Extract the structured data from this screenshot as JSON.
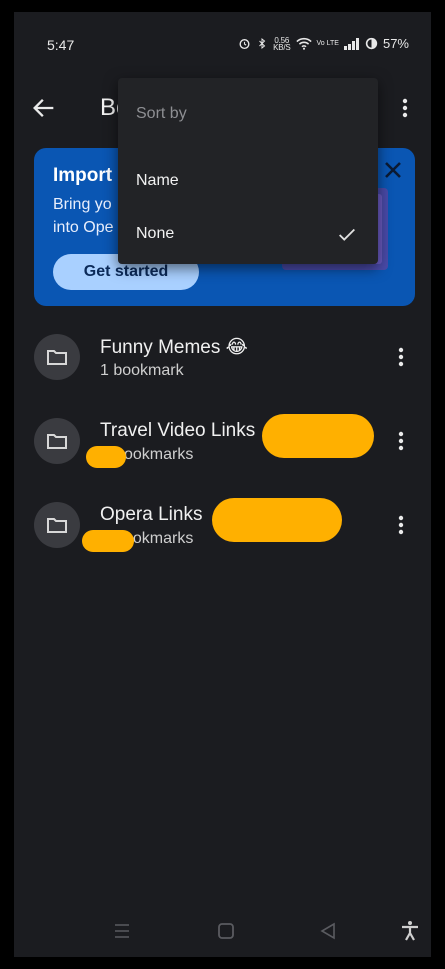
{
  "status_bar": {
    "time": "5:47",
    "net_speed_value": "0.56",
    "net_speed_unit": "KB/S",
    "volte": "Vo LTE",
    "battery": "57%"
  },
  "header": {
    "title_visible": "Bo",
    "back_icon": "arrow-back-icon",
    "more_icon": "more-vert-icon"
  },
  "banner": {
    "title": "Import",
    "body_line1": "Bring yo",
    "body_line2": "into Ope",
    "cta_label": "Get started",
    "colors": {
      "background": "#0a56b3",
      "cta": "#a9d0ff"
    }
  },
  "bookmarks": [
    {
      "title": "Funny Memes 😂",
      "subtitle": "1 bookmark"
    },
    {
      "title": "Travel Video Links",
      "subtitle": "ookmarks"
    },
    {
      "title": "Opera Links",
      "subtitle": "ookmarks"
    }
  ],
  "sort_menu": {
    "header": "Sort by",
    "options": [
      {
        "label": "Name",
        "selected": false
      },
      {
        "label": "None",
        "selected": true
      }
    ]
  },
  "colors": {
    "background": "#1b1c20",
    "redaction": "#ffb000",
    "menu": "#222326"
  }
}
